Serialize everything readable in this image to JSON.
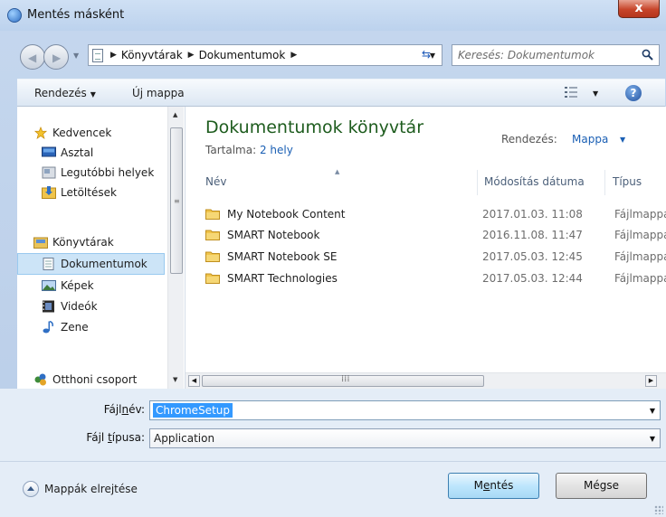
{
  "window": {
    "title": "Mentés másként",
    "close_label": "x"
  },
  "address": {
    "breadcrumbs": [
      "Könyvtárak",
      "Dokumentumok"
    ],
    "search_placeholder": "Keresés: Dokumentumok"
  },
  "toolbar": {
    "organize_label": "Rendezés",
    "new_folder_label": "Új mappa",
    "help_label": "?"
  },
  "nav": {
    "favorites": {
      "label": "Kedvencek",
      "items": [
        "Asztal",
        "Legutóbbi helyek",
        "Letöltések"
      ]
    },
    "libraries": {
      "label": "Könyvtárak",
      "items": [
        "Dokumentumok",
        "Képek",
        "Videók",
        "Zene"
      ]
    },
    "homegroup_label": "Otthoni csoport",
    "selected": "Dokumentumok"
  },
  "library": {
    "title": "Dokumentumok könyvtár",
    "contents_label": "Tartalma:",
    "contents_link": "2 hely",
    "arrange_label": "Rendezés:",
    "arrange_value": "Mappa"
  },
  "columns": {
    "name": "Név",
    "modified": "Módosítás dátuma",
    "type": "Típus"
  },
  "files": [
    {
      "name": "My Notebook Content",
      "modified": "2017.01.03. 11:08",
      "type": "Fájlmappa"
    },
    {
      "name": "SMART Notebook",
      "modified": "2016.11.08. 11:47",
      "type": "Fájlmappa"
    },
    {
      "name": "SMART Notebook SE",
      "modified": "2017.05.03. 12:45",
      "type": "Fájlmappa"
    },
    {
      "name": "SMART Technologies",
      "modified": "2017.05.03. 12:44",
      "type": "Fájlmappa"
    }
  ],
  "form": {
    "filename_label_pre": "Fájl",
    "filename_label_key": "n",
    "filename_label_post": "év:",
    "filename_value": "ChromeSetup",
    "filetype_label_pre": "Fájl ",
    "filetype_label_key": "t",
    "filetype_label_post": "ípusa:",
    "filetype_value": "Application"
  },
  "footer": {
    "hide_folders_label": "Mappák elrejtése",
    "save_pre": "M",
    "save_key": "e",
    "save_post": "ntés",
    "cancel_label": "Mégse"
  },
  "colors": {
    "library_title": "#1e5c1e",
    "link": "#1a5fb4",
    "selection": "#3399ff",
    "nav_selected": "#cce4f7"
  }
}
